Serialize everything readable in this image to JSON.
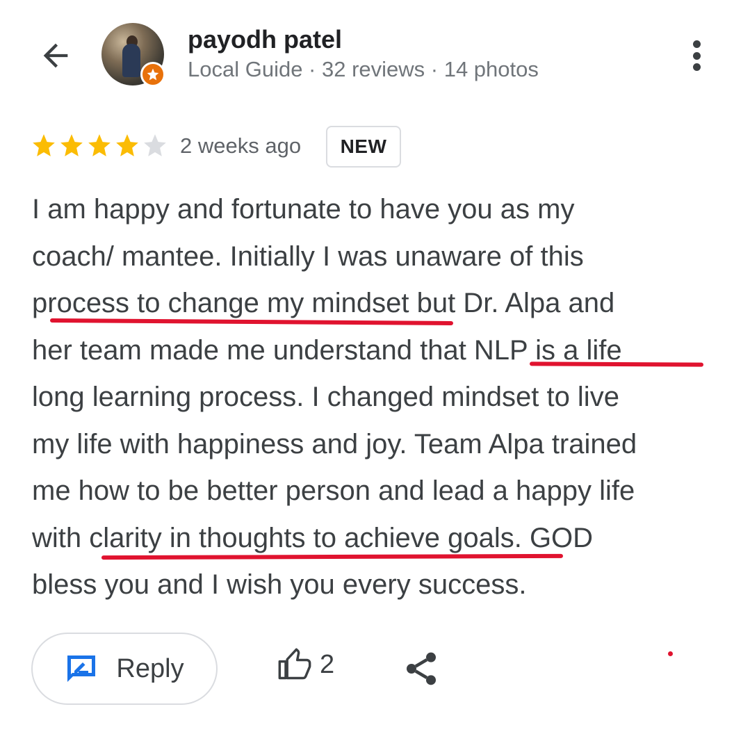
{
  "user": {
    "name": "payodh patel",
    "meta": "Local Guide · 32 reviews · 14 photos"
  },
  "review": {
    "rating": 4,
    "max_rating": 5,
    "time_ago": "2 weeks ago",
    "badge": "NEW",
    "lines": [
      "I am happy and fortunate to have you as my",
      "coach/ mantee. Initially I was unaware of this",
      "process to change my mindset but Dr. Alpa and",
      "her team made me understand that NLP is a life",
      "long learning process. I changed mindset to live",
      "my life with happiness and joy. Team Alpa trained",
      "me how to be better person and lead a happy life",
      "with clarity in thoughts to achieve goals. GOD",
      "bless you and I wish you every success."
    ],
    "underlined_phrases": [
      "process to change my mindset",
      "NLP is a life",
      "clarity in thoughts to achieve goals"
    ]
  },
  "actions": {
    "reply_label": "Reply",
    "like_count": "2"
  },
  "colors": {
    "star_filled": "#fbbc04",
    "star_empty": "#dadce0",
    "underline": "#e0132f",
    "reply_icon": "#1a73e8",
    "guide_badge": "#e8710a"
  },
  "icons": {
    "back": "arrow-left-icon",
    "more": "more-vert-icon",
    "reply": "reply-edit-icon",
    "like": "thumb-up-icon",
    "share": "share-icon"
  }
}
